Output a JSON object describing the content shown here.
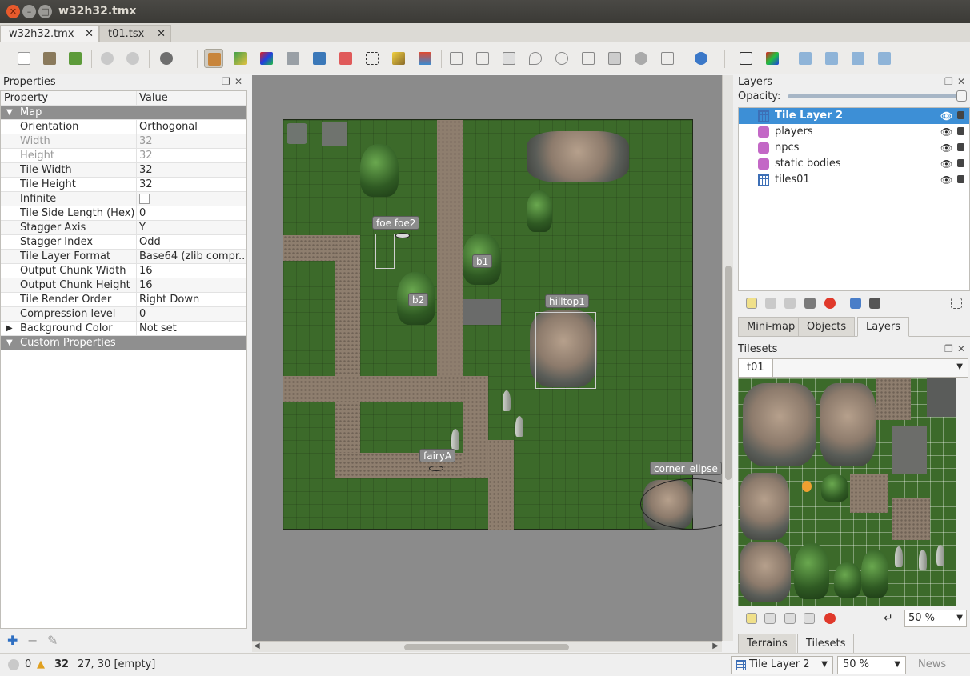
{
  "window": {
    "title": "w32h32.tmx",
    "close_glyph": "✕",
    "min_glyph": "–",
    "max_glyph": "□"
  },
  "tabs": [
    {
      "label": "w32h32.tmx",
      "close": "✕"
    },
    {
      "label": "t01.tsx",
      "close": "✕"
    }
  ],
  "toolbar": {
    "icons": [
      "new-map-icon",
      "open-icon",
      "save-icon",
      "undo-icon",
      "redo-icon",
      "commands-icon",
      "stamp-brush-icon",
      "terrain-brush-icon",
      "wang-brush-icon",
      "bucket-fill-icon",
      "shape-fill-icon",
      "eraser-icon",
      "rect-select-icon",
      "magic-wand-icon",
      "select-same-tile-icon",
      "select-objects-icon",
      "edit-polygons-icon",
      "insert-rectangle-icon",
      "insert-point-icon",
      "insert-ellipse-icon",
      "insert-polygon-icon",
      "insert-tile-icon",
      "insert-template-icon",
      "insert-text-icon",
      "move-icon",
      "random-mode-icon",
      "wang-fill-icon",
      "flip-horizontal-icon",
      "flip-vertical-icon",
      "rotate-left-icon",
      "rotate-right-icon"
    ],
    "accent": "#e45c2b"
  },
  "properties": {
    "title": "Properties",
    "col_property": "Property",
    "col_value": "Value",
    "group_map": "Map",
    "group_custom": "Custom Properties",
    "rows": [
      {
        "key": "Orientation",
        "value": "Orthogonal"
      },
      {
        "key": "Width",
        "value": "32"
      },
      {
        "key": "Height",
        "value": "32"
      },
      {
        "key": "Tile Width",
        "value": "32"
      },
      {
        "key": "Tile Height",
        "value": "32"
      },
      {
        "key": "Infinite",
        "value": ""
      },
      {
        "key": "Tile Side Length (Hex)",
        "value": "0"
      },
      {
        "key": "Stagger Axis",
        "value": "Y"
      },
      {
        "key": "Stagger Index",
        "value": "Odd"
      },
      {
        "key": "Tile Layer Format",
        "value": "Base64 (zlib compr..."
      },
      {
        "key": "Output Chunk Width",
        "value": "16"
      },
      {
        "key": "Output Chunk Height",
        "value": "16"
      },
      {
        "key": "Tile Render Order",
        "value": "Right Down"
      },
      {
        "key": "Compression level",
        "value": "0"
      },
      {
        "key": "Background Color",
        "value": "Not set"
      }
    ],
    "add_glyph": "✚",
    "remove_glyph": "−",
    "edit_glyph": "✎"
  },
  "map_objects": {
    "foe": "foe foe2",
    "b1": "b1",
    "b2": "b2",
    "hilltop": "hilltop1",
    "fairy": "fairyA",
    "corner": "corner_elipse"
  },
  "layers": {
    "title": "Layers",
    "opacity_label": "Opacity:",
    "items": [
      {
        "name": "Tile Layer 2",
        "type": "tile"
      },
      {
        "name": "players",
        "type": "object"
      },
      {
        "name": "npcs",
        "type": "object"
      },
      {
        "name": "static bodies",
        "type": "object"
      },
      {
        "name": "tiles01",
        "type": "tile"
      }
    ],
    "eye_glyph": "👁",
    "tabs": [
      "Mini-map",
      "Objects",
      "Layers"
    ]
  },
  "tilesets": {
    "title": "Tilesets",
    "current": "t01",
    "zoom": "50 %",
    "tabs": [
      "Terrains",
      "Tilesets"
    ]
  },
  "status": {
    "errors": "0",
    "warnings": "32",
    "position": "27, 30 [empty]",
    "layer": "Tile Layer 2",
    "zoom": "50 %",
    "news": "News"
  }
}
